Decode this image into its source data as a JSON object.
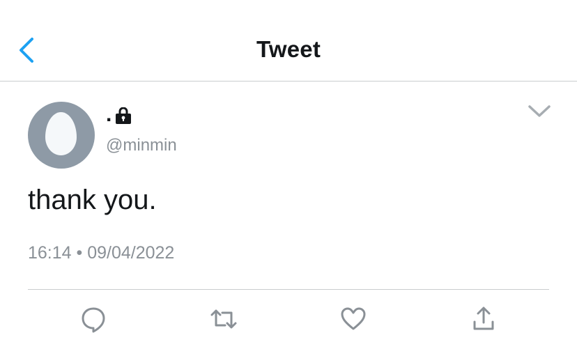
{
  "header": {
    "title": "Tweet",
    "back_icon": "chevron-left-icon"
  },
  "tweet": {
    "display_name": ".",
    "lock_icon": "lock-icon",
    "handle": "@minmin",
    "text": "thank you.",
    "meta": "16:14 • 09/04/2022",
    "menu_icon": "chevron-down-icon"
  },
  "actions": [
    {
      "name": "reply",
      "icon": "reply-icon"
    },
    {
      "name": "retweet",
      "icon": "retweet-icon"
    },
    {
      "name": "like",
      "icon": "heart-icon"
    },
    {
      "name": "share",
      "icon": "share-icon"
    }
  ],
  "colors": {
    "accent": "#1da1f2",
    "icon_gray": "#8a9096",
    "divider": "#c9ccce",
    "avatar_bg": "#8e9aa6"
  }
}
